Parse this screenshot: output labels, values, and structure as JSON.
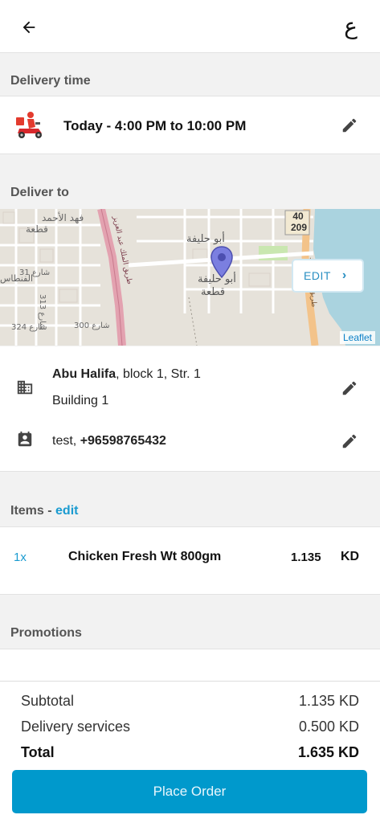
{
  "header": {
    "lang_label": "ع"
  },
  "delivery_time": {
    "section_title": "Delivery time",
    "text": "Today - 4:00 PM to 10:00 PM"
  },
  "deliver_to": {
    "section_title": "Deliver to",
    "map": {
      "route_badge_top": "40",
      "route_badge_bottom": "209",
      "edit_label": "EDIT",
      "attribution": "Leaflet",
      "labels": [
        "فهد الأحمد",
        "قطعة",
        "أبو حليفة",
        "أبو حليفة",
        "قطعة",
        "شارع 31",
        "شارع 313",
        "شارع 324",
        "شارع 300",
        "طريق الملك عبد العزيز",
        "طريق الملك فهد",
        "الفنطاس"
      ]
    },
    "address": {
      "area": "Abu Halifa",
      "rest": ", block 1, Str. 1",
      "line2": "Building 1"
    },
    "contact": {
      "name": "test, ",
      "phone": "+96598765432"
    }
  },
  "items": {
    "section_title": "Items - ",
    "edit_link": "edit",
    "list": [
      {
        "qty": "1x",
        "name": "Chicken Fresh Wt 800gm",
        "price": "1.135",
        "currency": "KD"
      }
    ]
  },
  "promotions": {
    "section_title": "Promotions"
  },
  "totals": {
    "subtotal_label": "Subtotal",
    "subtotal_value": "1.135 KD",
    "delivery_label": "Delivery services",
    "delivery_value": "0.500 KD",
    "total_label": "Total",
    "total_value": "1.635 KD"
  },
  "place_order_label": "Place Order",
  "colors": {
    "accent": "#0099cc",
    "link": "#1a9bd0",
    "pin": "#7b7fe0"
  }
}
